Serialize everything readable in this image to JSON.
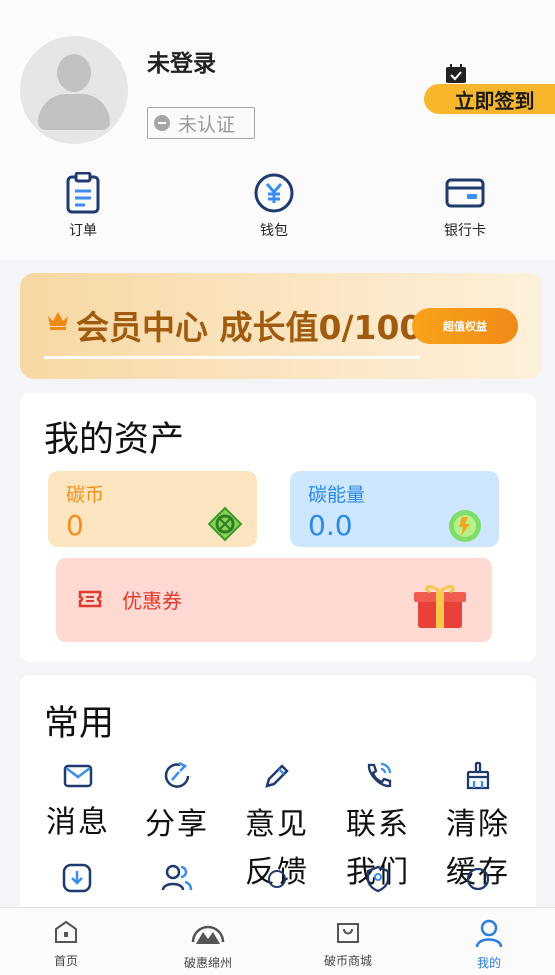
{
  "profile": {
    "username": "未登录",
    "verify_status": "未认证",
    "signin_label": "立即签到"
  },
  "quick_actions": [
    {
      "label": "订单"
    },
    {
      "label": "钱包"
    },
    {
      "label": "银行卡"
    }
  ],
  "vip": {
    "title": "会员中心 成长值0/100",
    "button": "超值权益"
  },
  "assets": {
    "title": "我的资产",
    "coin": {
      "label": "碳币",
      "value": "0"
    },
    "energy": {
      "label": "碳能量",
      "value": "0.0"
    },
    "coupon": {
      "label": "优惠券"
    }
  },
  "common": {
    "title": "常用",
    "items": [
      {
        "label": "消息"
      },
      {
        "label": "分享"
      },
      {
        "label": "意见反馈"
      },
      {
        "label": "联系我们"
      },
      {
        "label": "清除缓存"
      }
    ]
  },
  "tabs": [
    {
      "label": "首页"
    },
    {
      "label": "破惠绵州"
    },
    {
      "label": "破币商城"
    },
    {
      "label": "我的"
    }
  ],
  "colors": {
    "accent": "#2a7de1",
    "signin": "#f7b62b",
    "coin": "#f28f1e",
    "energy": "#2b8ae8",
    "coupon": "#e13b2f",
    "vip_text": "#a15b0f"
  }
}
